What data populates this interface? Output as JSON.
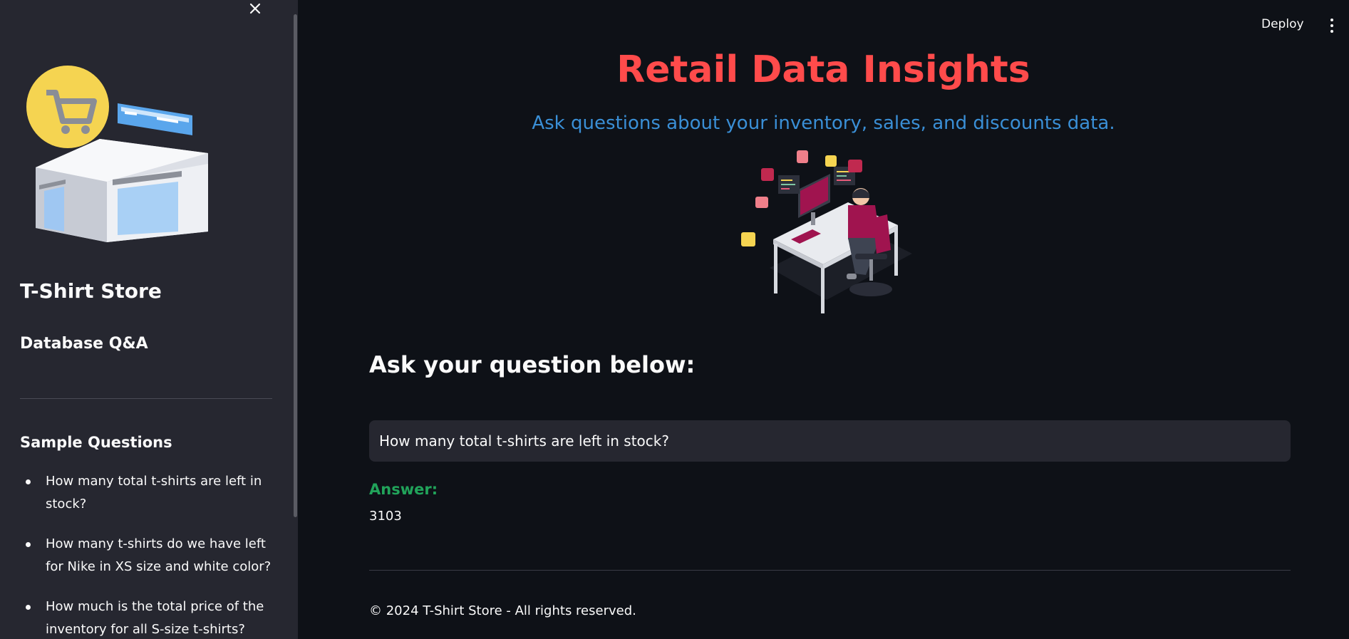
{
  "sidebar": {
    "close_icon": "close-icon",
    "store_name": "T-Shirt Store",
    "subtitle": "Database Q&A",
    "sample_title": "Sample Questions",
    "sample_questions": [
      "How many total t-shirts are left in stock?",
      "How many t-shirts do we have left for Nike in XS size and white color?",
      "How much is the total price of the inventory for all S-size t-shirts?"
    ]
  },
  "topbar": {
    "deploy_label": "Deploy",
    "menu_icon": "more-vertical-icon"
  },
  "main": {
    "title": "Retail Data Insights",
    "subtitle": "Ask questions about your inventory, sales, and discounts data.",
    "ask_heading": "Ask your question below:",
    "question_value": "How many total t-shirts are left in stock?",
    "answer_label": "Answer:",
    "answer_value": "3103",
    "footer": "© 2024 T-Shirt Store - All rights reserved."
  },
  "colors": {
    "background": "#0e1117",
    "sidebar": "#262730",
    "title": "#ff4b4b",
    "subtitle": "#3a8fd6",
    "answer": "#21a35a"
  }
}
